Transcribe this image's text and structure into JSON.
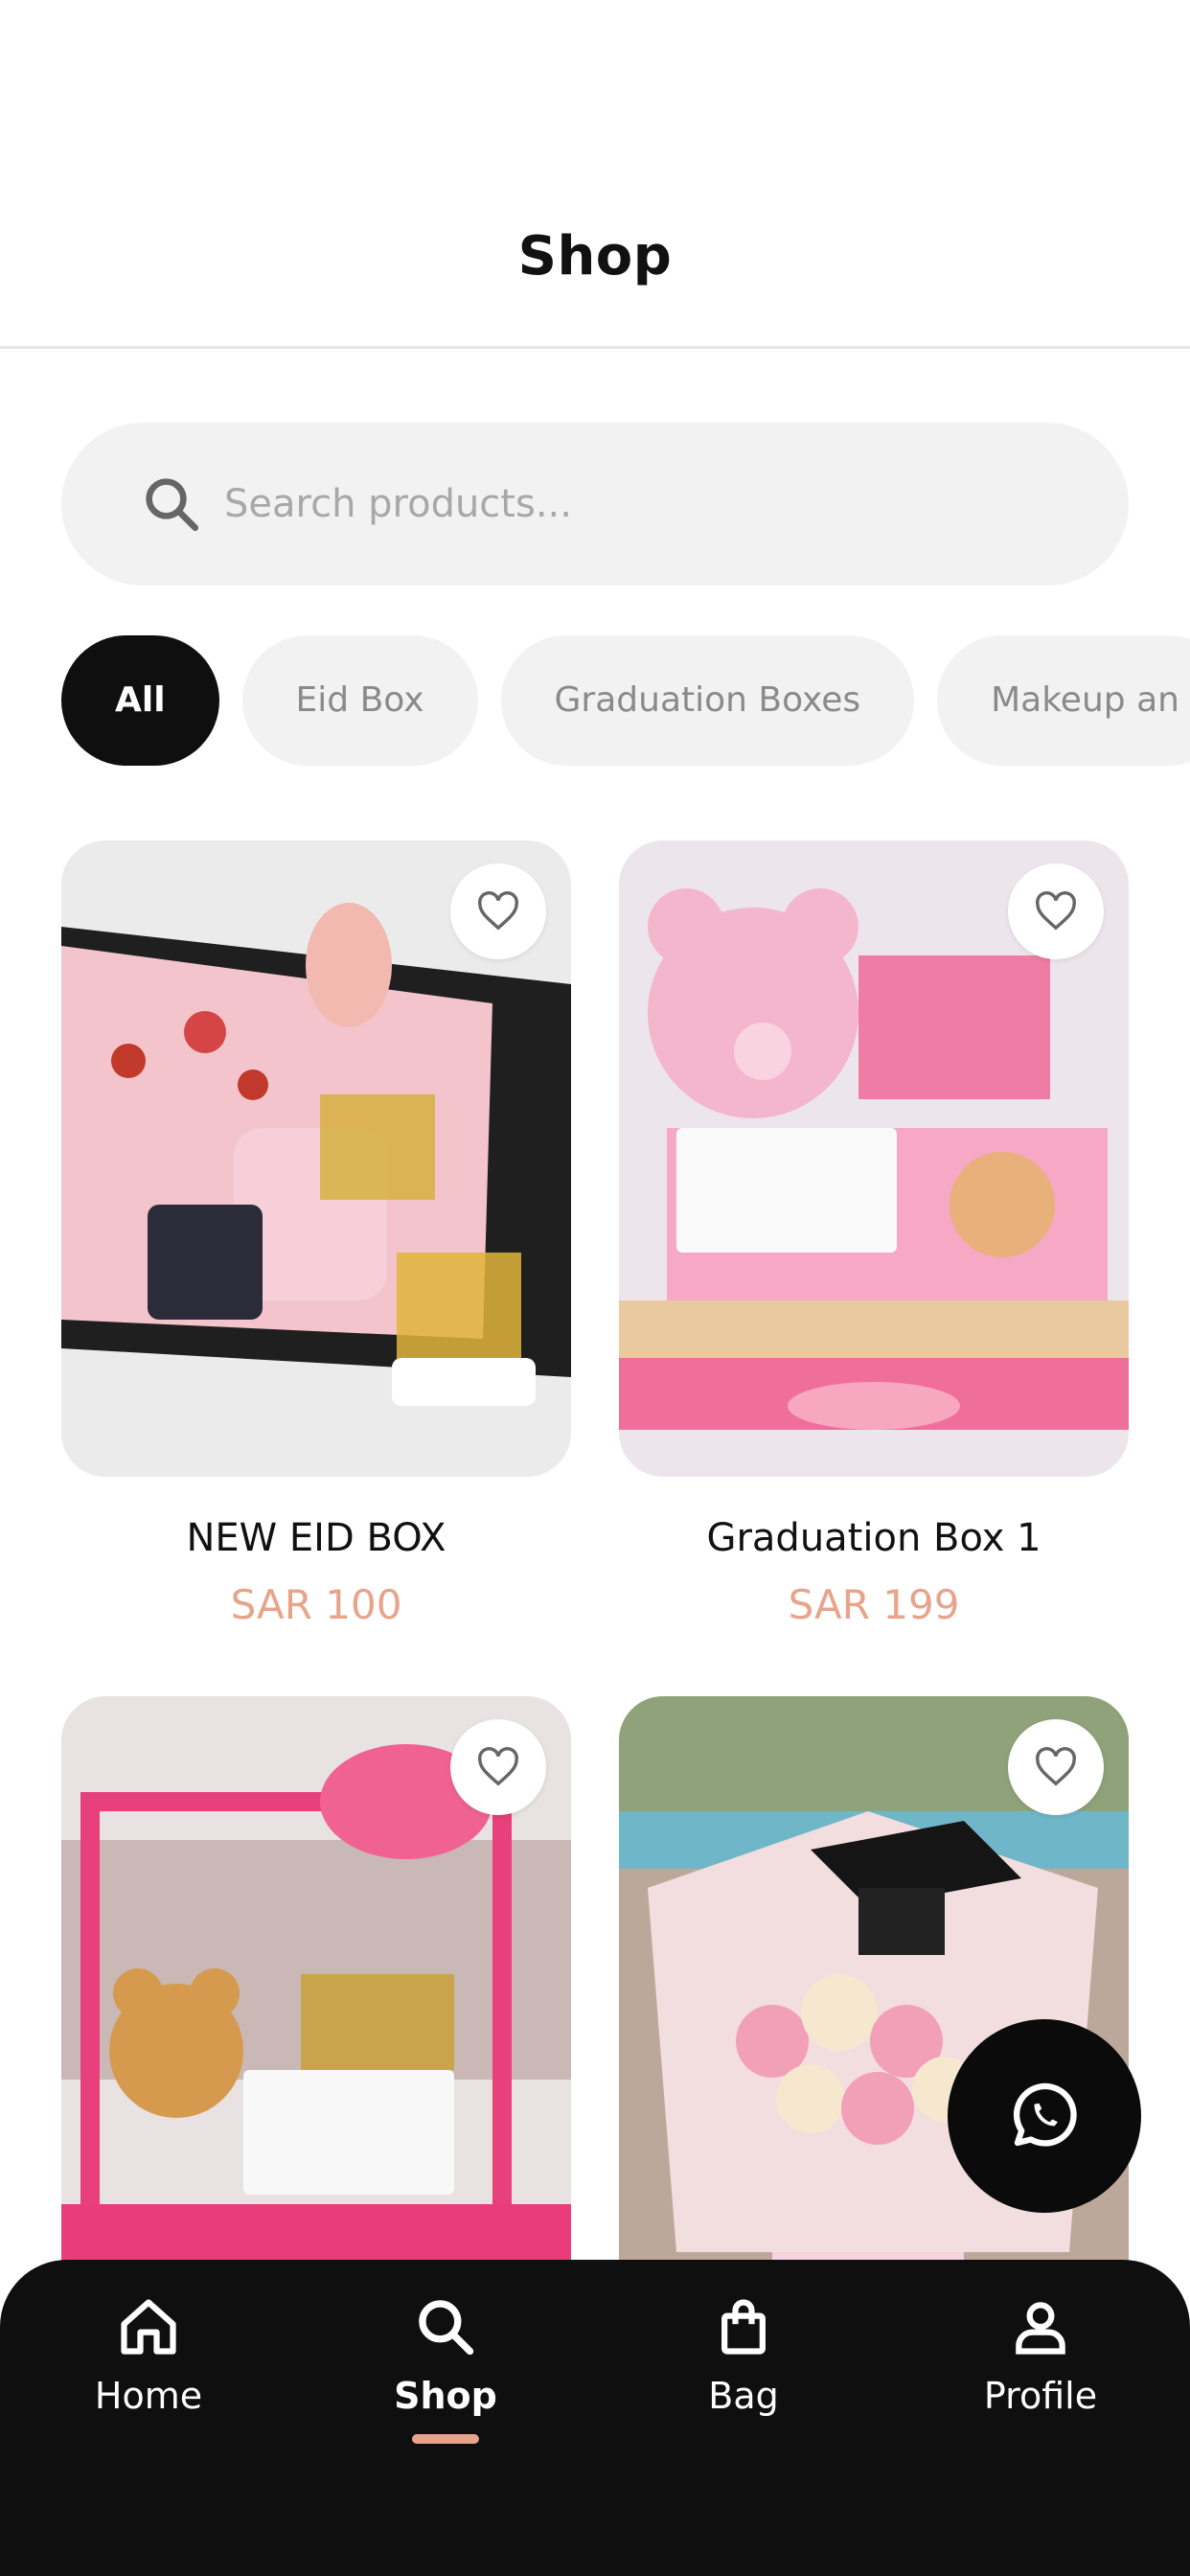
{
  "header": {
    "title": "Shop"
  },
  "search": {
    "placeholder": "Search products...",
    "icon": "search-icon"
  },
  "categories": [
    {
      "label": "All",
      "active": true
    },
    {
      "label": "Eid Box",
      "active": false
    },
    {
      "label": "Graduation Boxes",
      "active": false
    },
    {
      "label": "Makeup an",
      "active": false
    }
  ],
  "products": [
    {
      "name": "NEW EID BOX",
      "price": "SAR 100"
    },
    {
      "name": "Graduation Box 1",
      "price": "SAR 199"
    },
    {
      "name": "",
      "price": ""
    },
    {
      "name": "",
      "price": ""
    }
  ],
  "fab": {
    "icon": "whatsapp-icon"
  },
  "tabbar": {
    "items": [
      {
        "label": "Home",
        "icon": "home-icon",
        "active": false
      },
      {
        "label": "Shop",
        "icon": "search-icon",
        "active": true
      },
      {
        "label": "Bag",
        "icon": "bag-icon",
        "active": false
      },
      {
        "label": "Profile",
        "icon": "profile-icon",
        "active": false
      }
    ]
  },
  "colors": {
    "accent": "#e8a48b",
    "dark": "#0f0f0f",
    "chip_bg": "#f2f2f2"
  }
}
